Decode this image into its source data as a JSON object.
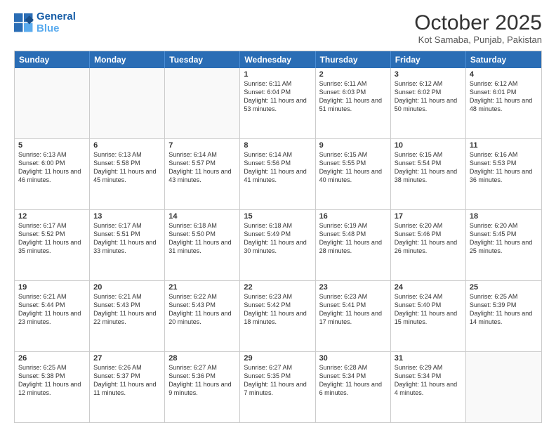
{
  "header": {
    "logo_line1": "General",
    "logo_line2": "Blue",
    "month": "October 2025",
    "location": "Kot Samaba, Punjab, Pakistan"
  },
  "days_of_week": [
    "Sunday",
    "Monday",
    "Tuesday",
    "Wednesday",
    "Thursday",
    "Friday",
    "Saturday"
  ],
  "rows": [
    [
      {
        "day": "",
        "info": ""
      },
      {
        "day": "",
        "info": ""
      },
      {
        "day": "",
        "info": ""
      },
      {
        "day": "1",
        "info": "Sunrise: 6:11 AM\nSunset: 6:04 PM\nDaylight: 11 hours and 53 minutes."
      },
      {
        "day": "2",
        "info": "Sunrise: 6:11 AM\nSunset: 6:03 PM\nDaylight: 11 hours and 51 minutes."
      },
      {
        "day": "3",
        "info": "Sunrise: 6:12 AM\nSunset: 6:02 PM\nDaylight: 11 hours and 50 minutes."
      },
      {
        "day": "4",
        "info": "Sunrise: 6:12 AM\nSunset: 6:01 PM\nDaylight: 11 hours and 48 minutes."
      }
    ],
    [
      {
        "day": "5",
        "info": "Sunrise: 6:13 AM\nSunset: 6:00 PM\nDaylight: 11 hours and 46 minutes."
      },
      {
        "day": "6",
        "info": "Sunrise: 6:13 AM\nSunset: 5:58 PM\nDaylight: 11 hours and 45 minutes."
      },
      {
        "day": "7",
        "info": "Sunrise: 6:14 AM\nSunset: 5:57 PM\nDaylight: 11 hours and 43 minutes."
      },
      {
        "day": "8",
        "info": "Sunrise: 6:14 AM\nSunset: 5:56 PM\nDaylight: 11 hours and 41 minutes."
      },
      {
        "day": "9",
        "info": "Sunrise: 6:15 AM\nSunset: 5:55 PM\nDaylight: 11 hours and 40 minutes."
      },
      {
        "day": "10",
        "info": "Sunrise: 6:15 AM\nSunset: 5:54 PM\nDaylight: 11 hours and 38 minutes."
      },
      {
        "day": "11",
        "info": "Sunrise: 6:16 AM\nSunset: 5:53 PM\nDaylight: 11 hours and 36 minutes."
      }
    ],
    [
      {
        "day": "12",
        "info": "Sunrise: 6:17 AM\nSunset: 5:52 PM\nDaylight: 11 hours and 35 minutes."
      },
      {
        "day": "13",
        "info": "Sunrise: 6:17 AM\nSunset: 5:51 PM\nDaylight: 11 hours and 33 minutes."
      },
      {
        "day": "14",
        "info": "Sunrise: 6:18 AM\nSunset: 5:50 PM\nDaylight: 11 hours and 31 minutes."
      },
      {
        "day": "15",
        "info": "Sunrise: 6:18 AM\nSunset: 5:49 PM\nDaylight: 11 hours and 30 minutes."
      },
      {
        "day": "16",
        "info": "Sunrise: 6:19 AM\nSunset: 5:48 PM\nDaylight: 11 hours and 28 minutes."
      },
      {
        "day": "17",
        "info": "Sunrise: 6:20 AM\nSunset: 5:46 PM\nDaylight: 11 hours and 26 minutes."
      },
      {
        "day": "18",
        "info": "Sunrise: 6:20 AM\nSunset: 5:45 PM\nDaylight: 11 hours and 25 minutes."
      }
    ],
    [
      {
        "day": "19",
        "info": "Sunrise: 6:21 AM\nSunset: 5:44 PM\nDaylight: 11 hours and 23 minutes."
      },
      {
        "day": "20",
        "info": "Sunrise: 6:21 AM\nSunset: 5:43 PM\nDaylight: 11 hours and 22 minutes."
      },
      {
        "day": "21",
        "info": "Sunrise: 6:22 AM\nSunset: 5:43 PM\nDaylight: 11 hours and 20 minutes."
      },
      {
        "day": "22",
        "info": "Sunrise: 6:23 AM\nSunset: 5:42 PM\nDaylight: 11 hours and 18 minutes."
      },
      {
        "day": "23",
        "info": "Sunrise: 6:23 AM\nSunset: 5:41 PM\nDaylight: 11 hours and 17 minutes."
      },
      {
        "day": "24",
        "info": "Sunrise: 6:24 AM\nSunset: 5:40 PM\nDaylight: 11 hours and 15 minutes."
      },
      {
        "day": "25",
        "info": "Sunrise: 6:25 AM\nSunset: 5:39 PM\nDaylight: 11 hours and 14 minutes."
      }
    ],
    [
      {
        "day": "26",
        "info": "Sunrise: 6:25 AM\nSunset: 5:38 PM\nDaylight: 11 hours and 12 minutes."
      },
      {
        "day": "27",
        "info": "Sunrise: 6:26 AM\nSunset: 5:37 PM\nDaylight: 11 hours and 11 minutes."
      },
      {
        "day": "28",
        "info": "Sunrise: 6:27 AM\nSunset: 5:36 PM\nDaylight: 11 hours and 9 minutes."
      },
      {
        "day": "29",
        "info": "Sunrise: 6:27 AM\nSunset: 5:35 PM\nDaylight: 11 hours and 7 minutes."
      },
      {
        "day": "30",
        "info": "Sunrise: 6:28 AM\nSunset: 5:34 PM\nDaylight: 11 hours and 6 minutes."
      },
      {
        "day": "31",
        "info": "Sunrise: 6:29 AM\nSunset: 5:34 PM\nDaylight: 11 hours and 4 minutes."
      },
      {
        "day": "",
        "info": ""
      }
    ]
  ]
}
